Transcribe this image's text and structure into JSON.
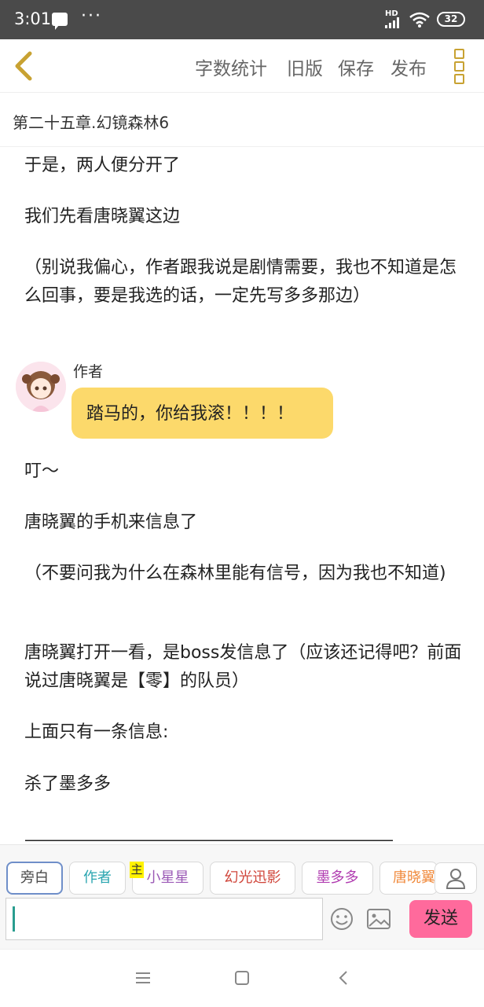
{
  "status_bar": {
    "time": "3:01",
    "network": "HD",
    "battery": "32"
  },
  "toolbar": {
    "word_count": "字数统计",
    "old_version": "旧版",
    "save": "保存",
    "publish": "发布"
  },
  "chapter": {
    "title": "第二十五章.幻镜森林6"
  },
  "content": {
    "p1": "于是，两人便分开了",
    "p2": "我们先看唐晓翼这边",
    "p3": "（别说我偏心，作者跟我说是剧情需要，我也不知道是怎么回事，要是我选的话，一定先写多多那边）",
    "dialog": {
      "speaker": "作者",
      "text": "踏马的，你给我滚！！！！"
    },
    "p4": "叮～",
    "p5": "唐晓翼的手机来信息了",
    "p6": "（不要问我为什么在森林里能有信号，因为我也不知道)",
    "p7": "唐晓翼打开一看，是boss发信息了（应该还记得吧？前面说过唐晓翼是【零】的队员）",
    "p8": "上面只有一条信息:",
    "p9": "杀了墨多多",
    "divider": "——————————————————————————"
  },
  "roles": [
    {
      "label": "旁白",
      "color": "#4a4a4a"
    },
    {
      "label": "作者",
      "color": "#2aa5b0"
    },
    {
      "label": "小星星",
      "color": "#9b59b6"
    },
    {
      "label": "幻光迅影",
      "color": "#d0453a"
    },
    {
      "label": "墨多多",
      "color": "#b03bb0"
    },
    {
      "label": "唐晓翼",
      "color": "#f08a3c"
    }
  ],
  "role_tag": "主",
  "composer": {
    "send": "发送"
  }
}
